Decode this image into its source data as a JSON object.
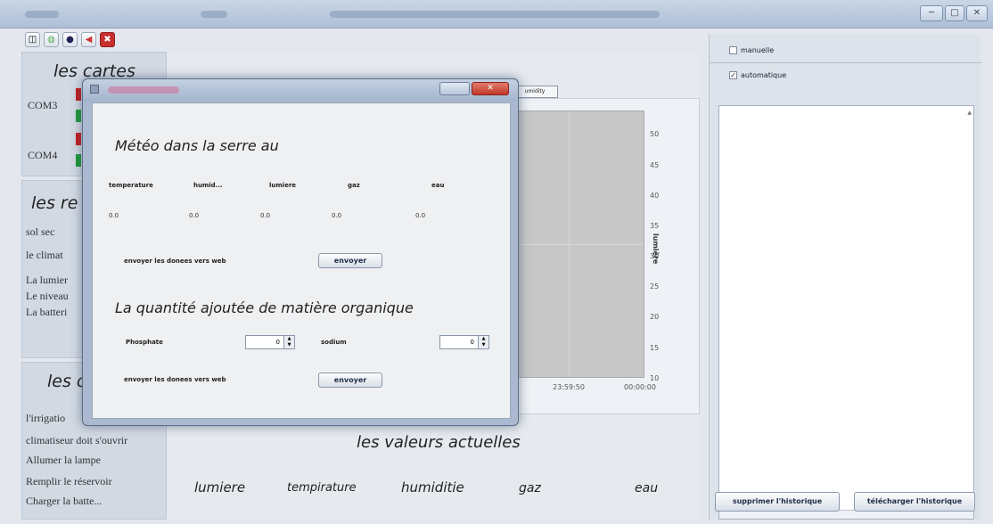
{
  "window": {
    "controls": [
      "─",
      "□",
      "✕"
    ]
  },
  "toolbar": {
    "tools": [
      "◫",
      "◍",
      "●",
      "◀",
      "✖"
    ]
  },
  "left": {
    "cartes_title": "les cartes",
    "ports": [
      "COM3",
      "COM4"
    ],
    "re_title": "les re",
    "re_items": [
      "sol sec",
      "le climat",
      "La lumier",
      "Le niveau",
      "La batteri"
    ],
    "c_title": "les c",
    "actions": [
      "l'irrigatio",
      "climatiseur doit s'ouvrir",
      "Allumer la lampe",
      "Remplir le réservoir",
      "Charger la batte..."
    ]
  },
  "main": {
    "tab_label": "umidity",
    "ylabel": "lumière",
    "yticks": [
      "50",
      "45",
      "40",
      "35",
      "30",
      "25",
      "20",
      "15",
      "10"
    ],
    "xticks": [
      "23:59:50",
      "00:00:00"
    ],
    "current_title": "les valeurs actuelles",
    "current_labels": [
      "lumiere",
      "tempirature",
      "humiditie",
      "gaz",
      "eau"
    ]
  },
  "right": {
    "manual": "manuelle",
    "auto": "automatique",
    "delete_btn": "supprimer l'historique",
    "download_btn": "télécharger l'historique"
  },
  "dialog": {
    "heading": "Météo dans la serre au",
    "sensors": [
      "temperature",
      "humid...",
      "lumiere",
      "gaz",
      "eau"
    ],
    "values": [
      "0.0",
      "0.0",
      "0.0",
      "0.0",
      "0.0"
    ],
    "send_label": "envoyer les donees vers web",
    "send_btn": "envoyer",
    "organic_heading": "La quantité ajoutée de matière organique",
    "phosphate": "Phosphate",
    "phosphate_value": "0",
    "sodium": "sodium",
    "sodium_value": "0",
    "send_label2": "envoyer les donees vers web",
    "send_btn2": "envoyer"
  }
}
